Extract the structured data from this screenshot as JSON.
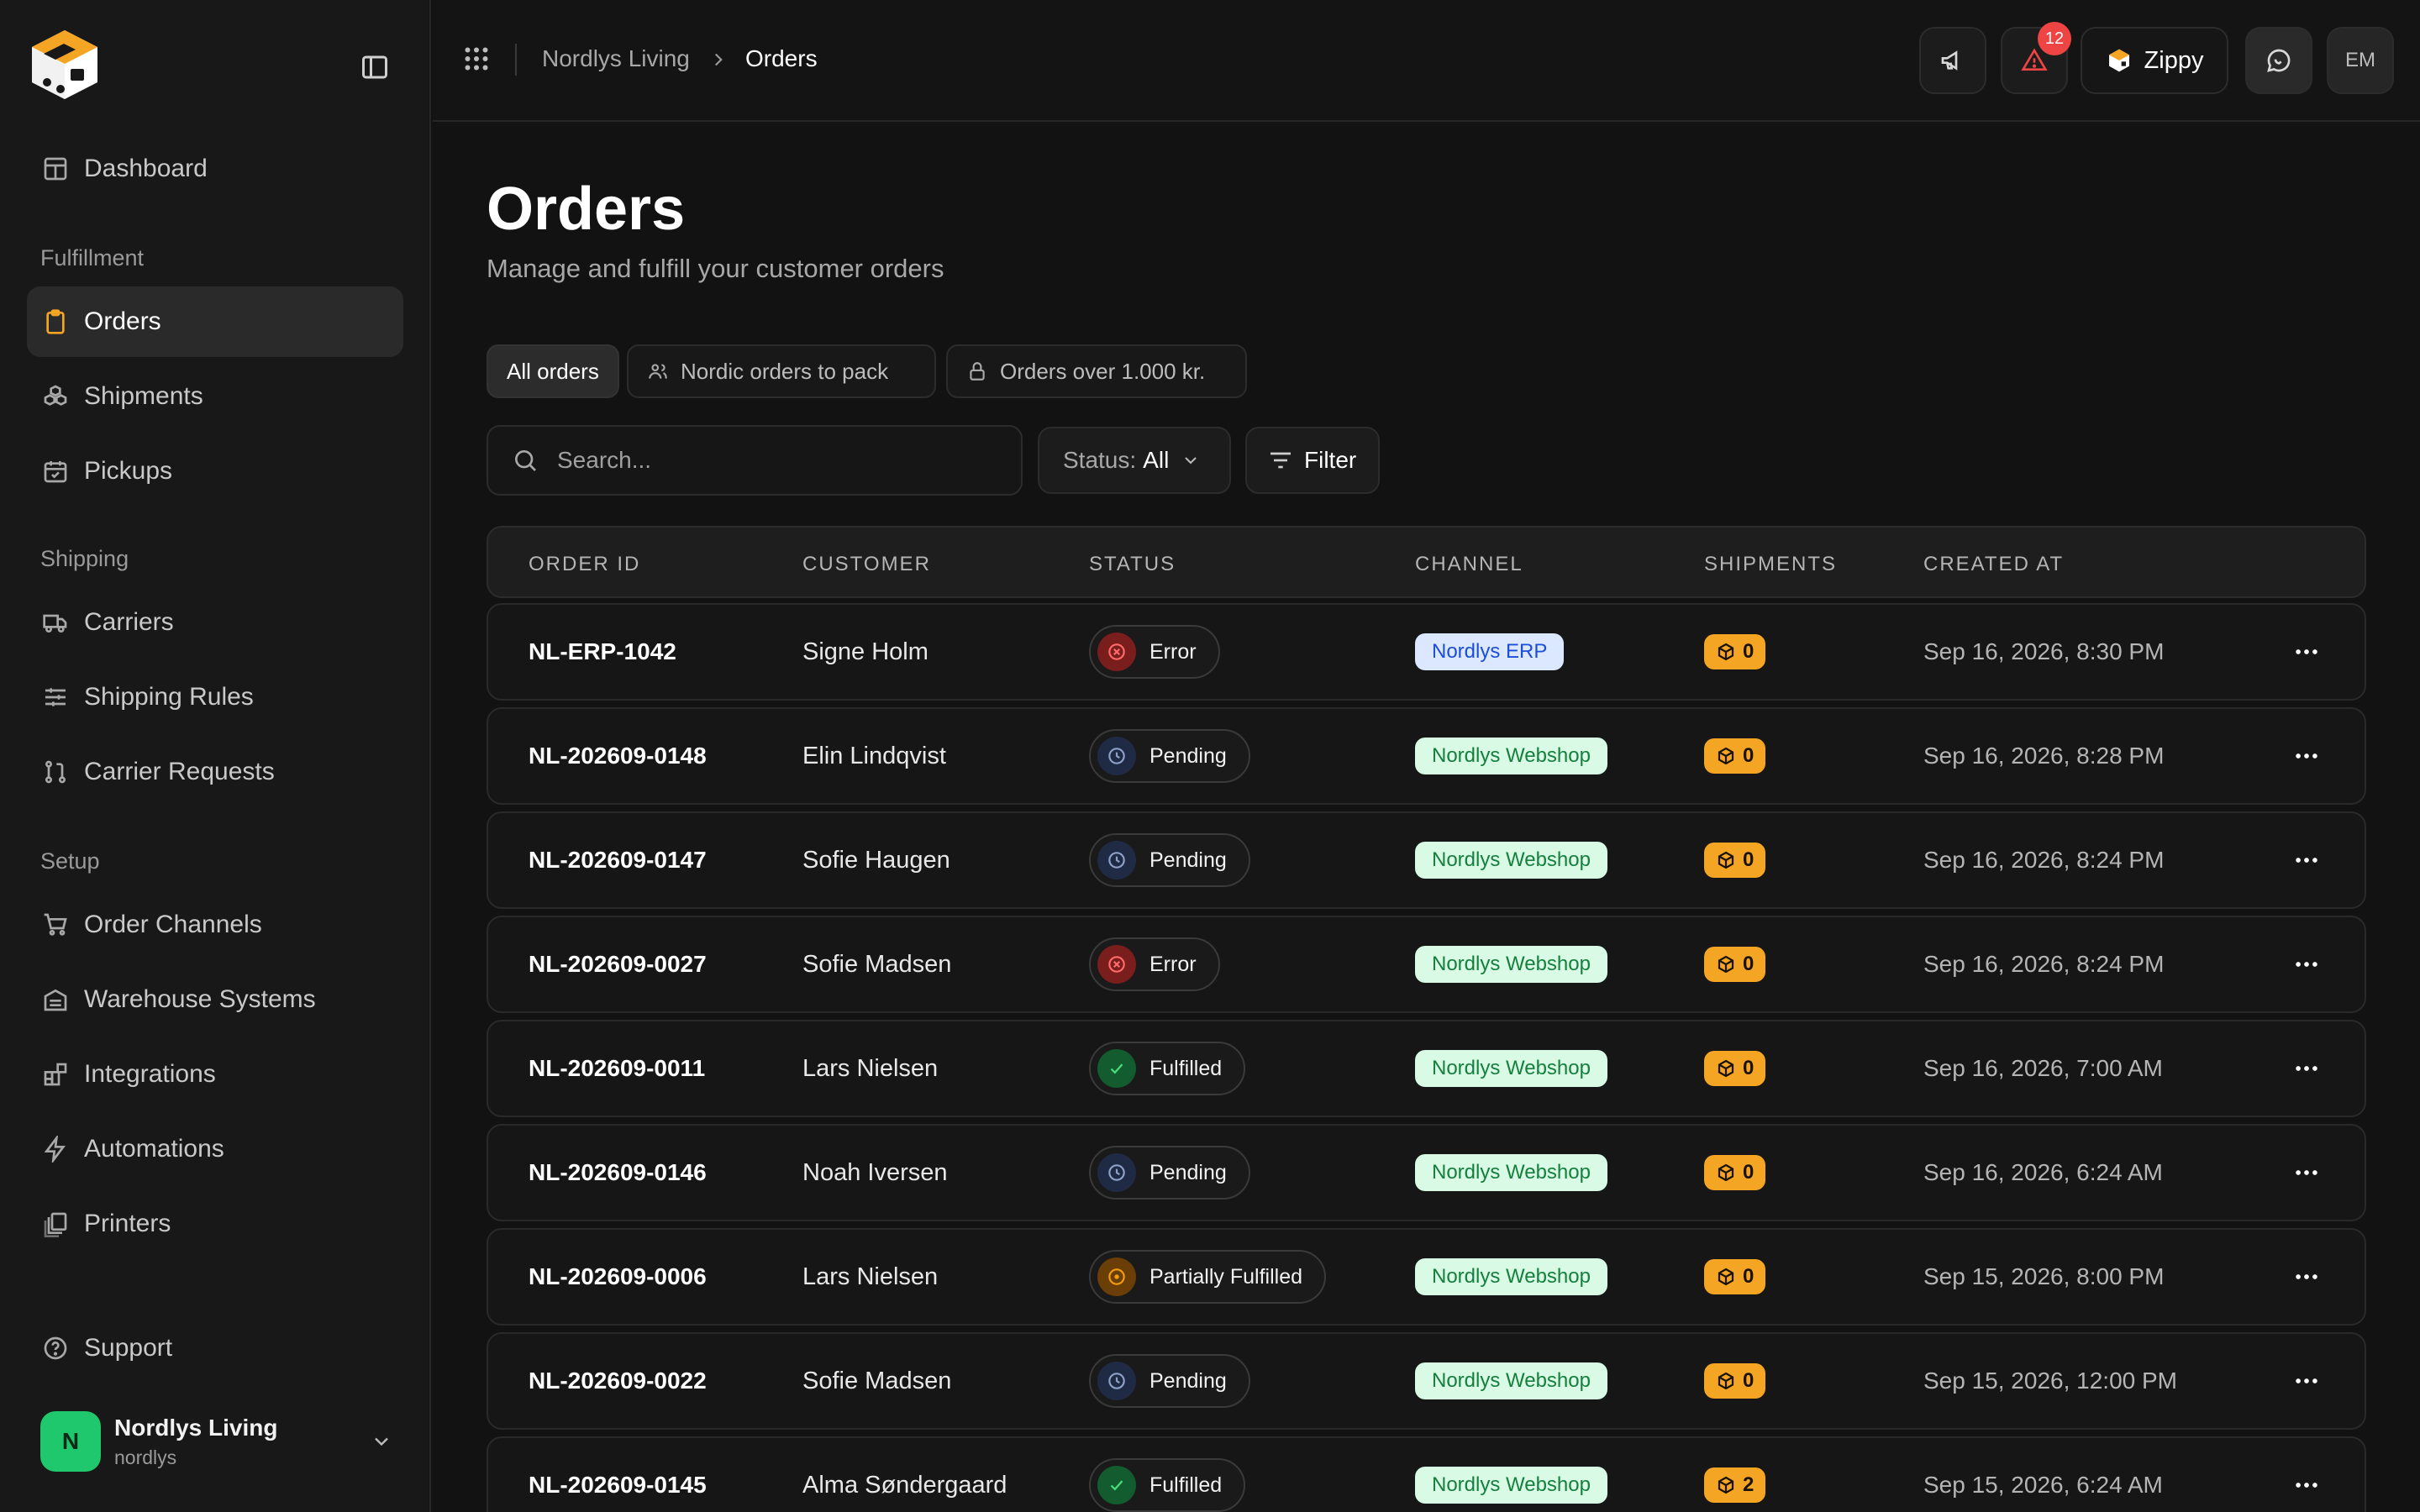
{
  "sidebar": {
    "brand_icon": "brand-cube-logo",
    "collapse_icon": "sidebar-toggle-icon",
    "top_items": [
      {
        "label": "Dashboard",
        "icon": "dashboard-icon"
      }
    ],
    "sections": [
      {
        "title": "Fulfillment",
        "items": [
          {
            "label": "Orders",
            "icon": "clipboard-icon",
            "active": true
          },
          {
            "label": "Shipments",
            "icon": "boxes-icon"
          },
          {
            "label": "Pickups",
            "icon": "calendar-icon"
          }
        ]
      },
      {
        "title": "Shipping",
        "items": [
          {
            "label": "Carriers",
            "icon": "truck-icon"
          },
          {
            "label": "Shipping Rules",
            "icon": "sliders-icon"
          },
          {
            "label": "Carrier Requests",
            "icon": "git-pull-icon"
          }
        ]
      },
      {
        "title": "Setup",
        "items": [
          {
            "label": "Order Channels",
            "icon": "cart-icon"
          },
          {
            "label": "Warehouse Systems",
            "icon": "warehouse-icon"
          },
          {
            "label": "Integrations",
            "icon": "blocks-icon"
          },
          {
            "label": "Automations",
            "icon": "zap-icon"
          },
          {
            "label": "Printers",
            "icon": "printer-icon"
          }
        ]
      }
    ],
    "support": {
      "label": "Support",
      "icon": "help-circle-icon"
    },
    "org": {
      "initial": "N",
      "name": "Nordlys Living",
      "slug": "nordlys",
      "color": "#1fc86c"
    }
  },
  "topbar": {
    "breadcrumb": {
      "parent": "Nordlys Living",
      "current": "Orders"
    },
    "alerts_count": "12",
    "assistant_label": "Zippy",
    "user_initials": "EM"
  },
  "main": {
    "title": "Orders",
    "subtitle": "Manage and fulfill your customer orders",
    "views": [
      {
        "label": "All orders",
        "active": true
      },
      {
        "label": "Nordic orders to pack",
        "icon": "users-icon"
      },
      {
        "label": "Orders over 1.000 kr.",
        "icon": "lock-icon"
      }
    ],
    "search_placeholder": "Search...",
    "status_filter": {
      "label": "Status:",
      "value": "All"
    },
    "filter_label": "Filter"
  },
  "table": {
    "columns": [
      "ORDER ID",
      "CUSTOMER",
      "STATUS",
      "CHANNEL",
      "SHIPMENTS",
      "CREATED AT"
    ],
    "rows": [
      {
        "id": "NL-ERP-1042",
        "customer": "Signe Holm",
        "status": "Error",
        "channel": "Nordlys ERP",
        "shipments": "0",
        "created": "Sep 16, 2026, 8:30 PM"
      },
      {
        "id": "NL-202609-0148",
        "customer": "Elin Lindqvist",
        "status": "Pending",
        "channel": "Nordlys Webshop",
        "shipments": "0",
        "created": "Sep 16, 2026, 8:28 PM"
      },
      {
        "id": "NL-202609-0147",
        "customer": "Sofie Haugen",
        "status": "Pending",
        "channel": "Nordlys Webshop",
        "shipments": "0",
        "created": "Sep 16, 2026, 8:24 PM"
      },
      {
        "id": "NL-202609-0027",
        "customer": "Sofie Madsen",
        "status": "Error",
        "channel": "Nordlys Webshop",
        "shipments": "0",
        "created": "Sep 16, 2026, 8:24 PM"
      },
      {
        "id": "NL-202609-0011",
        "customer": "Lars Nielsen",
        "status": "Fulfilled",
        "channel": "Nordlys Webshop",
        "shipments": "0",
        "created": "Sep 16, 2026, 7:00 AM"
      },
      {
        "id": "NL-202609-0146",
        "customer": "Noah Iversen",
        "status": "Pending",
        "channel": "Nordlys Webshop",
        "shipments": "0",
        "created": "Sep 16, 2026, 6:24 AM"
      },
      {
        "id": "NL-202609-0006",
        "customer": "Lars Nielsen",
        "status": "Partially Fulfilled",
        "channel": "Nordlys Webshop",
        "shipments": "0",
        "created": "Sep 15, 2026, 8:00 PM"
      },
      {
        "id": "NL-202609-0022",
        "customer": "Sofie Madsen",
        "status": "Pending",
        "channel": "Nordlys Webshop",
        "shipments": "0",
        "created": "Sep 15, 2026, 12:00 PM"
      },
      {
        "id": "NL-202609-0145",
        "customer": "Alma Søndergaard",
        "status": "Fulfilled",
        "channel": "Nordlys Webshop",
        "shipments": "2",
        "created": "Sep 15, 2026, 6:24 AM"
      }
    ]
  },
  "colors": {
    "accent": "#f5a524",
    "error": "#ef4444",
    "pending": "#8ea2c8",
    "fulfilled": "#22c55e",
    "partial": "#f59e0b",
    "webshop_bg": "#d9fbe5",
    "webshop_text": "#15803d",
    "erp_bg": "#dbe8ff",
    "erp_text": "#1d4ed8"
  }
}
